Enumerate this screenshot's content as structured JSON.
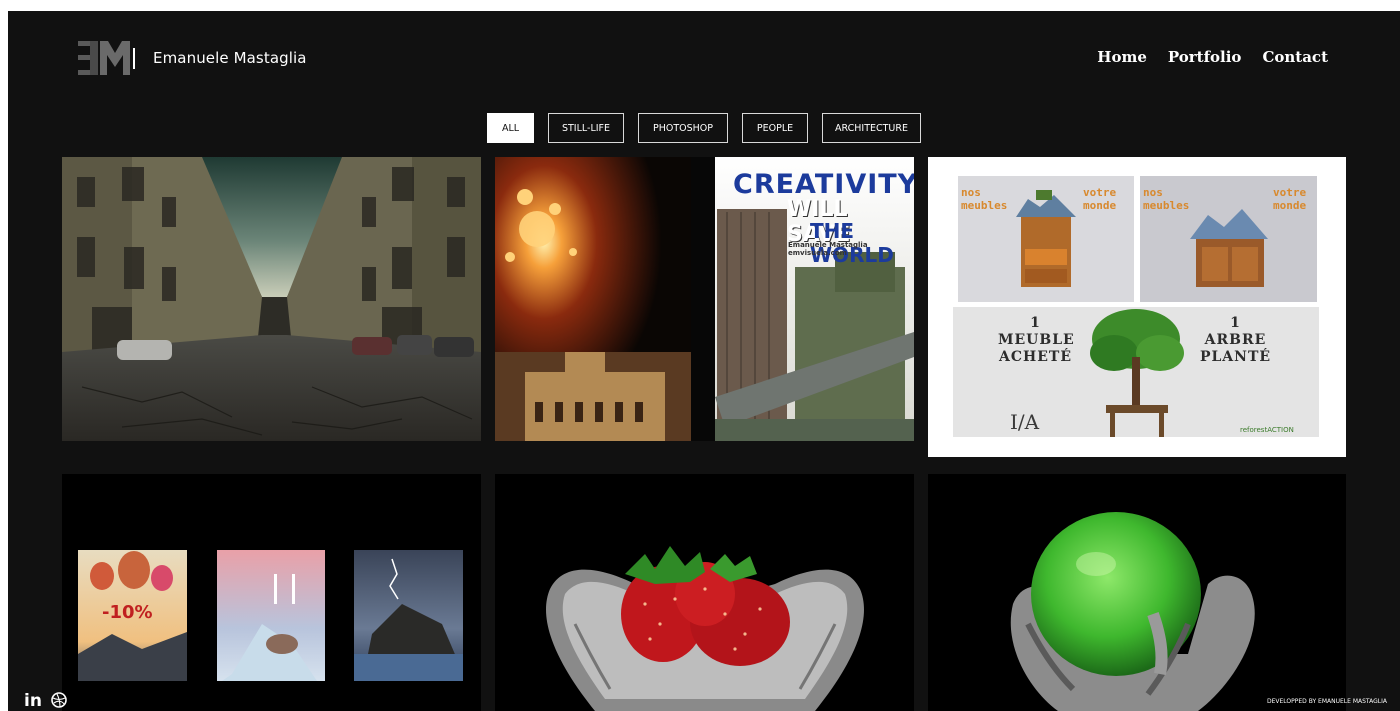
{
  "header": {
    "site_name": "Emanuele Mastaglia",
    "nav": [
      {
        "label": "Home"
      },
      {
        "label": "Portfolio"
      },
      {
        "label": "Contact"
      }
    ]
  },
  "filters": [
    {
      "label": "ALL",
      "active": true
    },
    {
      "label": "STILL-LIFE",
      "active": false
    },
    {
      "label": "PHOTOSHOP",
      "active": false
    },
    {
      "label": "PEOPLE",
      "active": false
    },
    {
      "label": "ARCHITECTURE",
      "active": false
    }
  ],
  "tiles": {
    "creativity": {
      "line1": "CREATIVITY",
      "line2": "WILL SAVE",
      "line3": "THE WORLD",
      "credit": "Emanuele Mastaglia emvisuela.com"
    },
    "meubles": {
      "nos_meubles": "nos meubles",
      "votre_monde": "votre monde",
      "left_text": "1 MEUBLE ACHETÉ",
      "right_text": "1 ARBRE PLANTÉ"
    },
    "balloons": {
      "discount": "-10%"
    }
  },
  "footer": {
    "linkedin": "in",
    "credit": "DEVELOPPED BY EMANUELE MASTAGLIA"
  },
  "colors": {
    "background": "#111111",
    "accent_blue": "#1c3b9c",
    "accent_orange": "#d8892e"
  }
}
